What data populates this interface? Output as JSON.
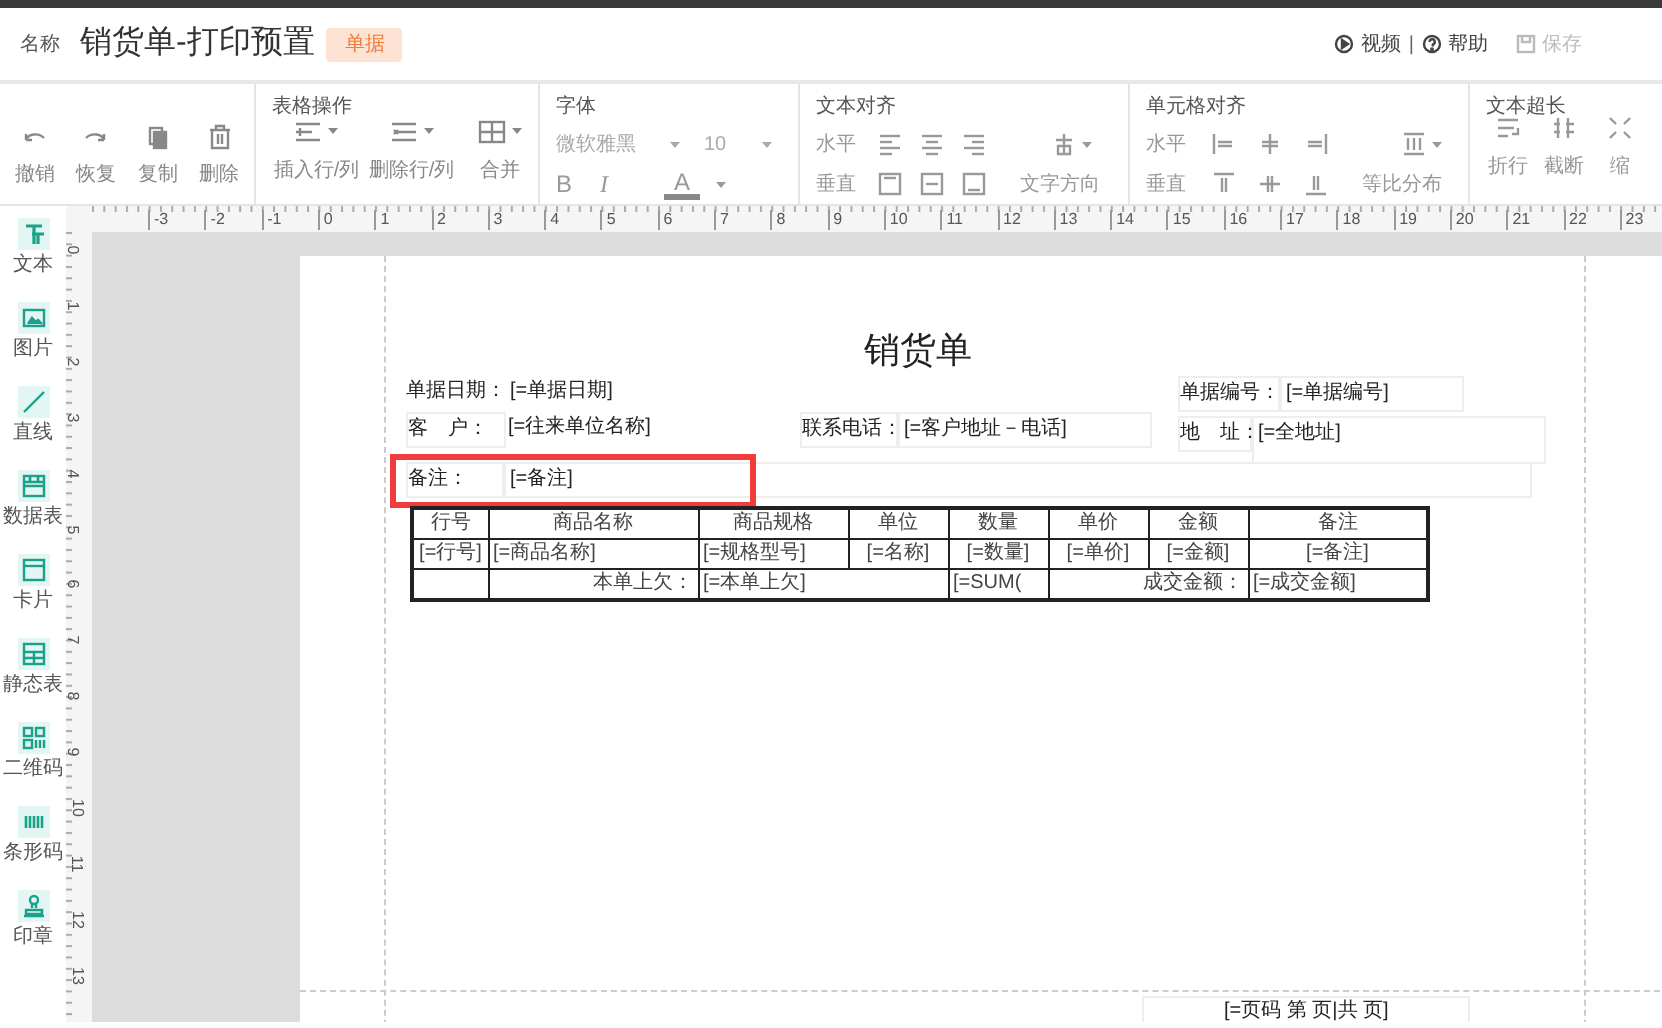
{
  "header": {
    "label": "名称",
    "title": "销货单-打印预置",
    "badge": "单据",
    "separator": "|",
    "links": [
      {
        "kind": "video",
        "text": "视频",
        "disabled": false
      },
      {
        "kind": "help",
        "text": "帮助",
        "disabled": false
      },
      {
        "kind": "save",
        "text": "保存",
        "disabled": true
      }
    ]
  },
  "toolbar": {
    "edit": [
      {
        "label": "撤销"
      },
      {
        "label": "恢复"
      },
      {
        "label": "复制"
      },
      {
        "label": "删除"
      }
    ],
    "table_ops": {
      "title": "表格操作",
      "items": [
        {
          "label": "插入行/列"
        },
        {
          "label": "删除行/列"
        },
        {
          "label": "合并"
        }
      ]
    },
    "font": {
      "title": "字体",
      "family": "微软雅黑",
      "size": "10",
      "bold": "B",
      "italic": "I",
      "color_label": "A"
    },
    "text_align": {
      "title": "文本对齐",
      "horizontal": "水平",
      "vertical": "垂直",
      "direction": "文字方向"
    },
    "cell_align": {
      "title": "单元格对齐",
      "horizontal": "水平",
      "vertical": "垂直",
      "distribute": "等比分布"
    },
    "overflow": {
      "title": "文本超长",
      "items": [
        {
          "label": "折行"
        },
        {
          "label": "截断"
        },
        {
          "label": "缩"
        }
      ]
    }
  },
  "sidebar": {
    "items": [
      {
        "label": "文本"
      },
      {
        "label": "图片"
      },
      {
        "label": "直线"
      },
      {
        "label": "数据表"
      },
      {
        "label": "卡片"
      },
      {
        "label": "静态表"
      },
      {
        "label": "二维码"
      },
      {
        "label": "条形码"
      },
      {
        "label": "印章"
      }
    ]
  },
  "rulers": {
    "horizontal": [
      "-3",
      "-2",
      "-1",
      "0",
      "1",
      "2",
      "3",
      "4",
      "5",
      "6",
      "7",
      "8",
      "9",
      "10",
      "11",
      "12",
      "13",
      "14",
      "15",
      "16",
      "17",
      "18",
      "19",
      "20",
      "21",
      "22",
      "23"
    ],
    "vertical": [
      "0",
      "1",
      "2",
      "3",
      "4",
      "5",
      "6",
      "7",
      "8",
      "9",
      "10",
      "11",
      "12",
      "13"
    ]
  },
  "document": {
    "title": "销货单",
    "fields": [
      {
        "label": "单据日期：",
        "value": "[=单据日期]",
        "selected": false
      },
      {
        "label": "客　户：",
        "value": "[=往来单位名称]",
        "selected": false
      },
      {
        "label": "联系电话：",
        "value": "[=客户地址－电话]",
        "selected": false
      },
      {
        "label": "单据编号：",
        "value": "[=单据编号]",
        "selected": false
      },
      {
        "label": "地　址：",
        "value": "[=全地址]",
        "selected": false
      },
      {
        "label": "备注：",
        "value": "[=备注]",
        "selected": true
      }
    ],
    "table": {
      "columns": [
        "行号",
        "商品名称",
        "商品规格",
        "单位",
        "数量",
        "单价",
        "金额",
        "备注"
      ],
      "row": [
        "[=行号]",
        "[=商品名称]",
        "[=规格型号]",
        "[=名称]",
        "[=数量]",
        "[=单价]",
        "[=金额]",
        "[=备注]"
      ],
      "summary": [
        {
          "kind": "label",
          "text": "本单上欠："
        },
        {
          "kind": "value",
          "text": "[=本单上欠]"
        },
        {
          "kind": "value",
          "text": "[=SUM("
        },
        {
          "kind": "label",
          "text": "成交金额："
        },
        {
          "kind": "value",
          "text": "[=成交金额]"
        }
      ]
    },
    "page_number": "[=页码 第 页|共 页]"
  }
}
